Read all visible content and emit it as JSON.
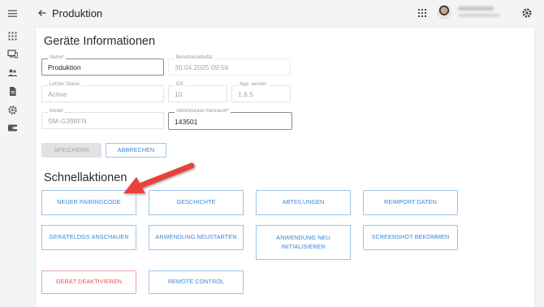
{
  "header": {
    "title": "Produktion"
  },
  "device_info": {
    "section_title": "Geräte Informationen",
    "fields": {
      "name": {
        "label": "Name*",
        "value": "Produktion"
      },
      "last_activity": {
        "label": "Benutzeraktivität",
        "value": "30.04.2025 09:56"
      },
      "last_status": {
        "label": "Letzter Status",
        "value": "Active"
      },
      "os": {
        "label": "OS",
        "value": "10"
      },
      "app_version": {
        "label": "App. version",
        "value": "1.6.5"
      },
      "model": {
        "label": "Model",
        "value": "SM-G398FN"
      },
      "admin_password": {
        "label": "Administrator Kennwort*",
        "value": "143501"
      }
    },
    "save_label": "SPEICHERN",
    "cancel_label": "ABBRECHEN"
  },
  "quick_actions": {
    "section_title": "Schnellaktionen",
    "buttons": [
      "NEUER PAIRINGCODE",
      "GESCHICHTE",
      "ABTEILUNGEN",
      "REIMPORT DATEN",
      "GERÄTELOGS ANSCHAUEN",
      "ANWENDUNG NEUSTARTEN",
      "ANWENDUNG NEU INITIALISIEREN",
      "SCREENSHOT BEKOMMEN",
      "GERÄT DEAKTIVIEREN",
      "REMOTE CONTROL"
    ]
  },
  "icons": {
    "sidebar": [
      "menu-icon",
      "apps-grid-icon",
      "devices-icon",
      "users-icon",
      "document-icon",
      "settings-icon",
      "wallet-icon"
    ],
    "topbar": [
      "back-arrow-icon",
      "apps-grid-icon",
      "gear-icon"
    ]
  },
  "colors": {
    "accent": "#3a87d6",
    "danger": "#e2544f",
    "annotation_arrow": "#e8433a"
  }
}
